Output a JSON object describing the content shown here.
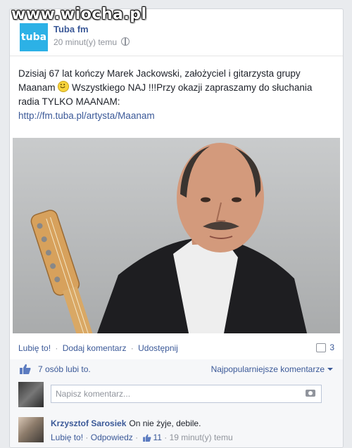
{
  "watermark": "www.wiocha.pl",
  "post": {
    "page_name": "Tuba fm",
    "logo_text": "tuba",
    "timestamp": "20 minut(y) temu",
    "text_main": "Dzisiaj 67 lat kończy Marek Jackowski, założyciel i gitarzysta grupy Maanam",
    "text_after_smiley": " Wszystkiego NAJ !!!Przy okazji zapraszamy do słuchania radia TYLKO MAANAM:",
    "link": "http://fm.tuba.pl/artysta/Maanam"
  },
  "actions": {
    "like": "Lubię to!",
    "comment": "Dodaj komentarz",
    "share": "Udostępnij",
    "separator": "·",
    "comment_count": "3"
  },
  "likes": {
    "text": "7 osób lubi to.",
    "sort": "Najpopularniejsze komentarze"
  },
  "composer": {
    "placeholder": "Napisz komentarz..."
  },
  "comment": {
    "author": "Krzysztof Sarosiek",
    "text": "On nie żyje, debile.",
    "like": "Lubię to!",
    "reply": "Odpowiedz",
    "likes_count": "11",
    "time": "19 minut(y) temu",
    "separator": "·"
  },
  "colors": {
    "link": "#3b5998",
    "logo": "#2cb1e6"
  }
}
